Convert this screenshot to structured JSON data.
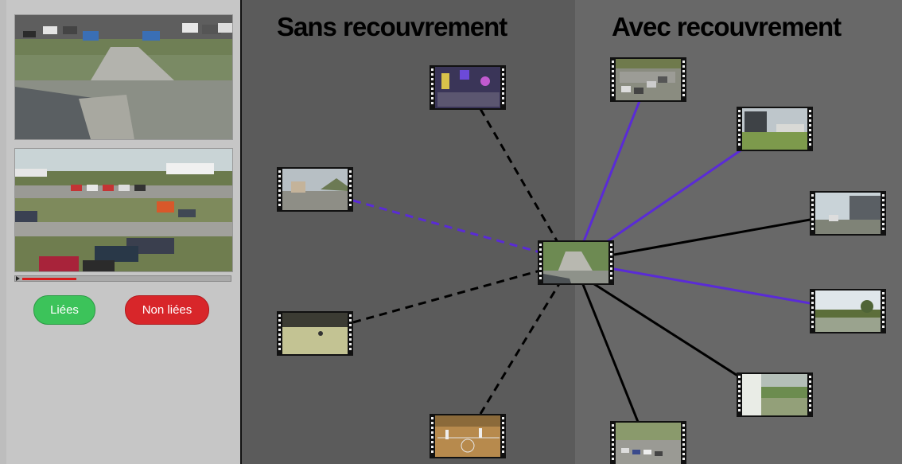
{
  "left_panel": {
    "video_1": {
      "description_icon": "aerial-parking-camera-view"
    },
    "video_2": {
      "description_icon": "parking-lot-camera-view"
    },
    "progress": 0.26,
    "buttons": {
      "linked": "Liées",
      "unlinked": "Non liées"
    }
  },
  "graph": {
    "left_title": "Sans recouvrement",
    "right_title": "Avec recouvrement",
    "colors": {
      "left_bg": "#5b5b5b",
      "right_bg": "#686868",
      "linked_edge": "#5a2bd6",
      "dashed_edge": "#000000",
      "solid_edge": "#000000",
      "progress": "#d81b1b",
      "btn_green": "#3cc35a",
      "btn_red": "#d8262a"
    },
    "center_node": "parking-path-thumbnail",
    "left_nodes": [
      {
        "name": "night-square-thumbnail",
        "edge": "dashed-black"
      },
      {
        "name": "street-houses-thumbnail",
        "edge": "dashed-purple"
      },
      {
        "name": "gym-floor-thumbnail",
        "edge": "dashed-black"
      },
      {
        "name": "basketball-court-thumbnail",
        "edge": "dashed-black"
      }
    ],
    "right_nodes": [
      {
        "name": "parking-cars-thumbnail",
        "edge": "solid-purple"
      },
      {
        "name": "building-lawn-thumbnail",
        "edge": "solid-purple"
      },
      {
        "name": "building-right-thumbnail",
        "edge": "solid-black"
      },
      {
        "name": "trees-field-thumbnail",
        "edge": "solid-purple"
      },
      {
        "name": "window-view-thumbnail",
        "edge": "solid-black"
      },
      {
        "name": "aerial-parking-thumbnail",
        "edge": "solid-black"
      }
    ]
  }
}
